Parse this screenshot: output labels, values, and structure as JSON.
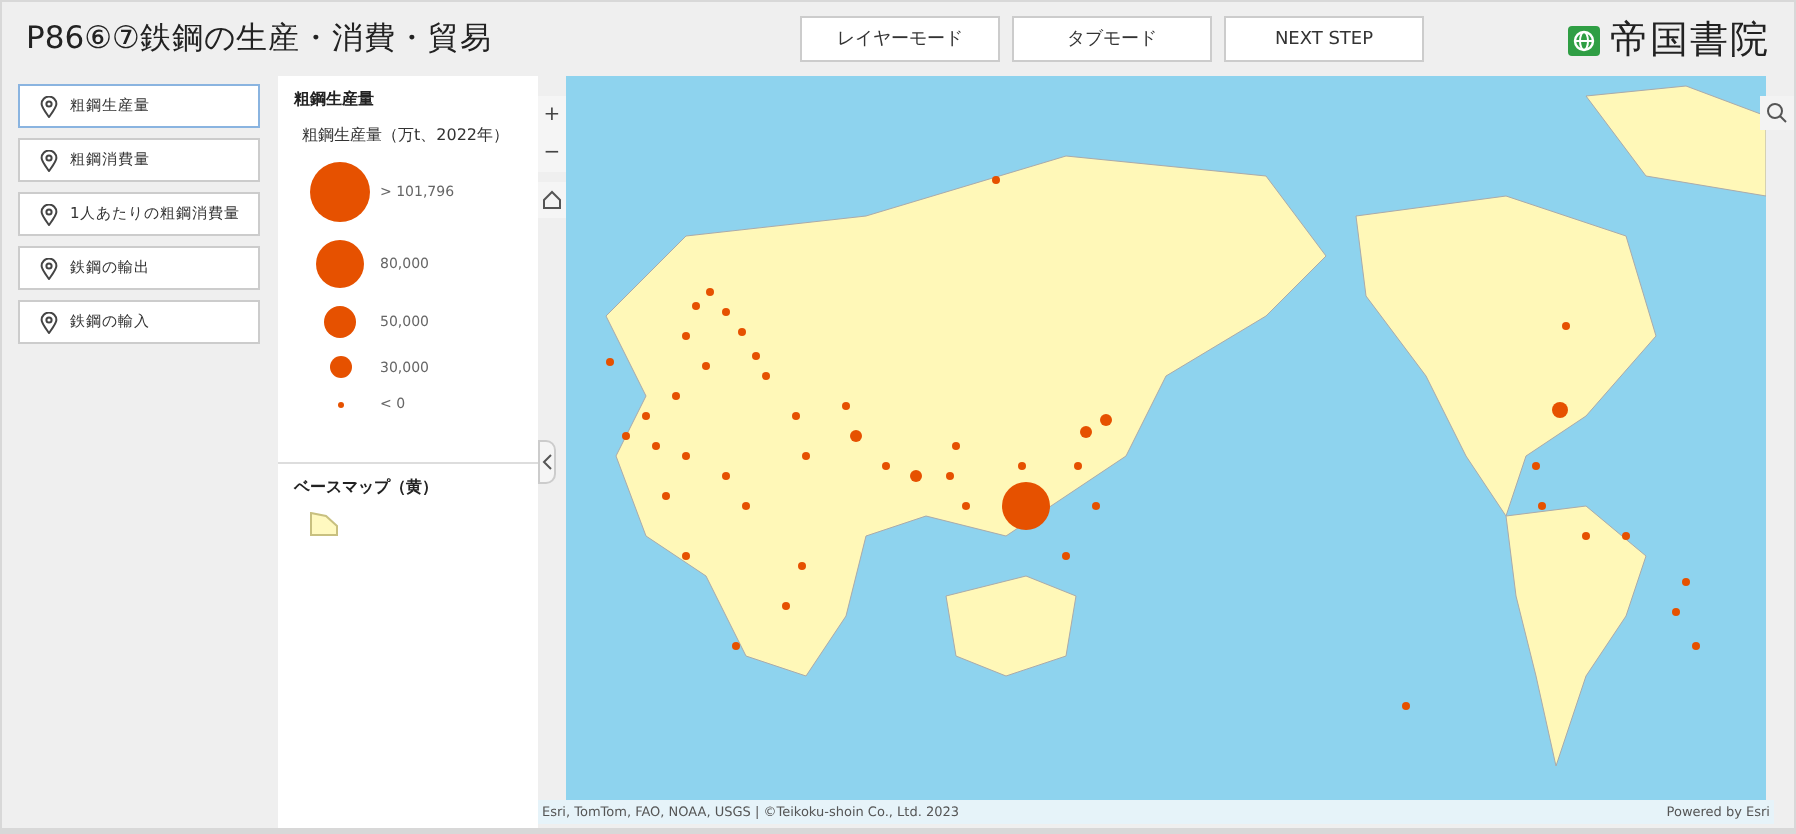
{
  "header": {
    "title": "P86⑥⑦鉄鋼の生産・消費・貿易",
    "buttons": [
      "レイヤーモード",
      "タブモード",
      "NEXT STEP"
    ],
    "logo_text": "帝国書院"
  },
  "sidebar": {
    "items": [
      {
        "label": "粗鋼生産量",
        "selected": true
      },
      {
        "label": "粗鋼消費量",
        "selected": false
      },
      {
        "label": "1人あたりの粗鋼消費量",
        "selected": false
      },
      {
        "label": "鉄鋼の輸出",
        "selected": false
      },
      {
        "label": "鉄鋼の輸入",
        "selected": false
      }
    ]
  },
  "legend": {
    "title": "粗鋼生産量",
    "subtitle": "粗鋼生産量（万t、2022年）",
    "sizes": [
      {
        "label": "> 101,796"
      },
      {
        "label": "80,000"
      },
      {
        "label": "50,000"
      },
      {
        "label": "30,000"
      },
      {
        "label": "< 0"
      }
    ],
    "basemap_title": "ベースマップ（黄）"
  },
  "map": {
    "zoom_controls": [
      "+",
      "−"
    ],
    "attribution": "Esri, TomTom, FAO, NOAA, USGS | ©Teikoku-shoin Co., Ltd. 2023",
    "powered_by": "Powered by Esri"
  }
}
